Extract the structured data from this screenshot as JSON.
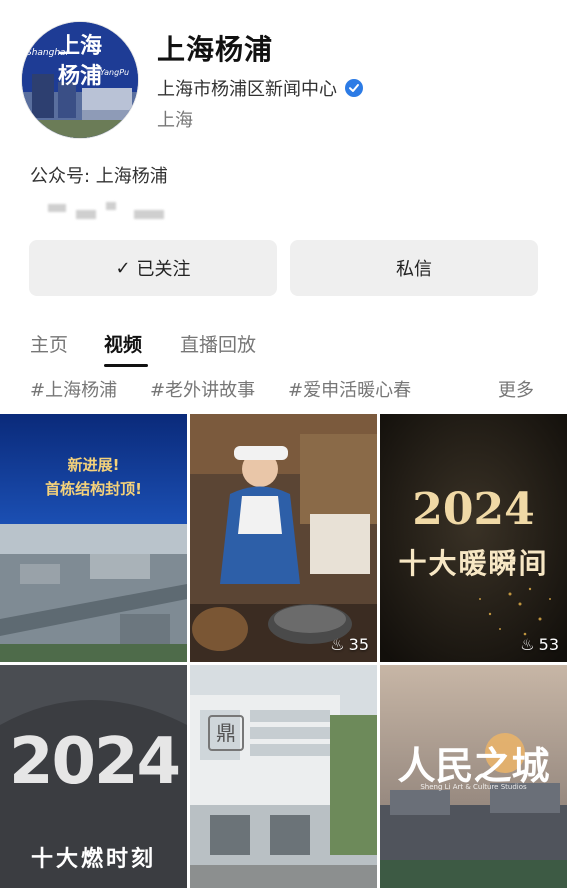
{
  "profile": {
    "avatar_text_cn": "上海",
    "avatar_text_cn2": "杨浦",
    "avatar_text_en": "Shanghai",
    "avatar_text_en2": "YangPu",
    "name": "上海杨浦",
    "org": "上海市杨浦区新闻中心",
    "location": "上海",
    "public_account": "公众号: 上海杨浦"
  },
  "buttons": {
    "follow_label": "已关注",
    "message_label": "私信"
  },
  "tabs": [
    "主页",
    "视频",
    "直播回放"
  ],
  "tags": [
    "#上海杨浦",
    "#老外讲故事",
    "#爱申活暖心春",
    "更多"
  ],
  "videos": [
    {
      "line1": "新进展!",
      "line2": "首栋结构封顶!",
      "plays": ""
    },
    {
      "plays": "35"
    },
    {
      "year": "2024",
      "subtitle": "十大暖瞬间",
      "plays": "53"
    },
    {
      "year": "2024",
      "subtitle": "十大燃时刻"
    },
    {
      "logo": "鼎"
    },
    {
      "title": "人民之城",
      "caption": "Sheng Li Art & Culture Studios"
    }
  ],
  "colors": {
    "verified": "#2c7be5",
    "button_bg": "#efefef",
    "accent_gold": "#f5d27a"
  }
}
